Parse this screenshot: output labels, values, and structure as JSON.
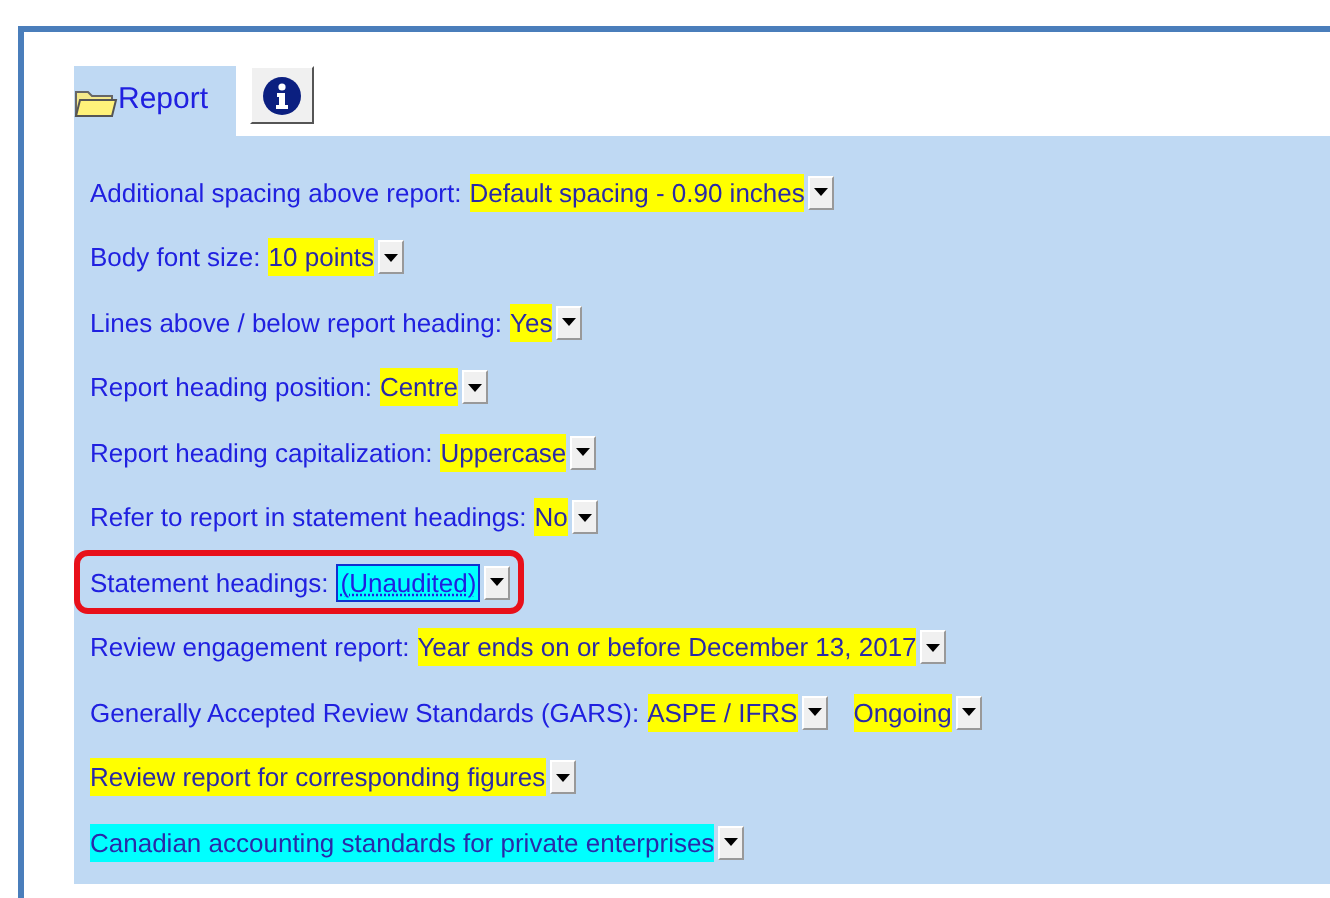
{
  "tabs": [
    {
      "kind": "folder",
      "label": "Report",
      "selected": true
    },
    {
      "kind": "info",
      "selected": false
    }
  ],
  "rows": [
    {
      "label": "Additional spacing above report:",
      "outlined": false,
      "dropdowns": [
        {
          "value": "Default spacing - 0.90 inches",
          "color": "#ffff00",
          "focused": false
        }
      ]
    },
    {
      "label": "Body font size:",
      "outlined": false,
      "dropdowns": [
        {
          "value": "10 points",
          "color": "#ffff00",
          "focused": false
        }
      ]
    },
    {
      "label": "Lines above / below report heading:",
      "outlined": false,
      "dropdowns": [
        {
          "value": "Yes",
          "color": "#ffff00",
          "focused": false
        }
      ]
    },
    {
      "label": "Report heading position:",
      "outlined": false,
      "dropdowns": [
        {
          "value": "Centre",
          "color": "#ffff00",
          "focused": false
        }
      ]
    },
    {
      "label": "Report heading capitalization:",
      "outlined": false,
      "dropdowns": [
        {
          "value": "Uppercase",
          "color": "#ffff00",
          "focused": false
        }
      ]
    },
    {
      "label": "Refer to report in statement headings:",
      "outlined": false,
      "dropdowns": [
        {
          "value": "No",
          "color": "#ffff00",
          "focused": false
        }
      ]
    },
    {
      "label": "Statement headings:",
      "outlined": true,
      "dropdowns": [
        {
          "value": "(Unaudited)",
          "color": "#00ffff",
          "focused": true
        }
      ]
    },
    {
      "label": "Review engagement report:",
      "outlined": false,
      "dropdowns": [
        {
          "value": "Year ends on or before December 13, 2017",
          "color": "#ffff00",
          "focused": false
        }
      ]
    },
    {
      "label": "Generally Accepted Review Standards (GARS):",
      "outlined": false,
      "dropdowns": [
        {
          "value": "ASPE / IFRS",
          "color": "#ffff00",
          "focused": false
        },
        {
          "value": "Ongoing",
          "color": "#ffff00",
          "focused": false
        }
      ]
    },
    {
      "outlined": false,
      "dropdowns": [
        {
          "value": "Review report for corresponding figures",
          "color": "#ffff00",
          "focused": false
        }
      ]
    },
    {
      "outlined": false,
      "dropdowns": [
        {
          "value": "Canadian accounting standards for private enterprises",
          "color": "#00ffff",
          "focused": false
        }
      ]
    }
  ]
}
